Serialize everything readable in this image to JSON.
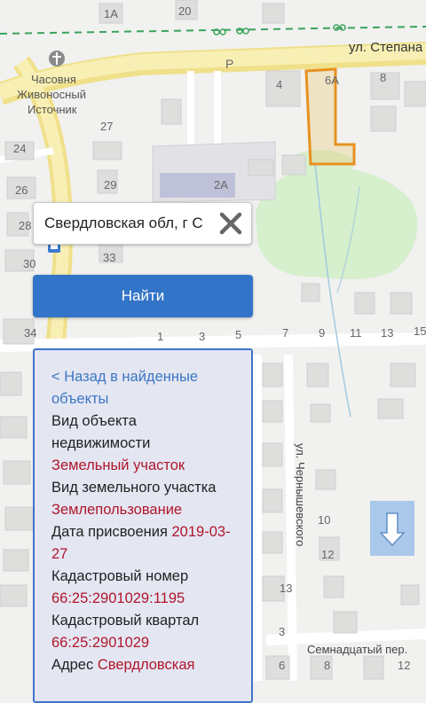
{
  "map": {
    "street_top": "ул. Степана",
    "chapel_line1": "Часовня",
    "chapel_line2": "Живоносный",
    "chapel_line3": "Источник",
    "street_chernyshevsky": "ул. Чернышевского",
    "street_16th": "Семнадцатый пер.",
    "parking_label": "P",
    "house_numbers": {
      "h1A": "1А",
      "h20": "20",
      "h4": "4",
      "h6A": "6А",
      "h8": "8",
      "h27": "27",
      "h24": "24",
      "h2A": "2А",
      "h26": "26",
      "h29": "29",
      "h28": "28",
      "h33": "33",
      "h30": "30",
      "h34": "34",
      "h1": "1",
      "h3": "3",
      "h5": "5",
      "h7": "7",
      "h9": "9",
      "h11": "11",
      "h13": "13",
      "h15": "15",
      "h10": "10",
      "h12": "12",
      "h13b": "13",
      "h3b": "3",
      "h6": "6",
      "h8b": "8",
      "h12b": "12"
    }
  },
  "search": {
    "value": "Свердловская обл, г С"
  },
  "find_button_label": "Найти",
  "info": {
    "back_link": "< Назад в найденные объекты",
    "object_type_label": "Вид объекта недвижимости",
    "object_type_value": "Земельный участок",
    "land_type_label": "Вид земельного участка",
    "land_type_value": "Землепользование",
    "date_label": "Дата присвоения",
    "date_value": "2019-03-27",
    "cadastral_number_label": "Кадастровый номер",
    "cadastral_number_value": "66:25:2901029:1195",
    "cadastral_block_label": "Кадастровый квартал",
    "cadastral_block_value": "66:25:2901029",
    "address_label": "Адрес",
    "address_value": "Свердловская"
  },
  "colors": {
    "accent": "#3274c8",
    "value_red": "#b0162b",
    "parcel_orange": "#e8911f",
    "park_green": "#d6efcc"
  },
  "icons": {
    "chapel": "cross-icon",
    "bus_stop": "bus-stop-icon",
    "clear": "close-icon",
    "nav": "arrow-down-icon"
  }
}
